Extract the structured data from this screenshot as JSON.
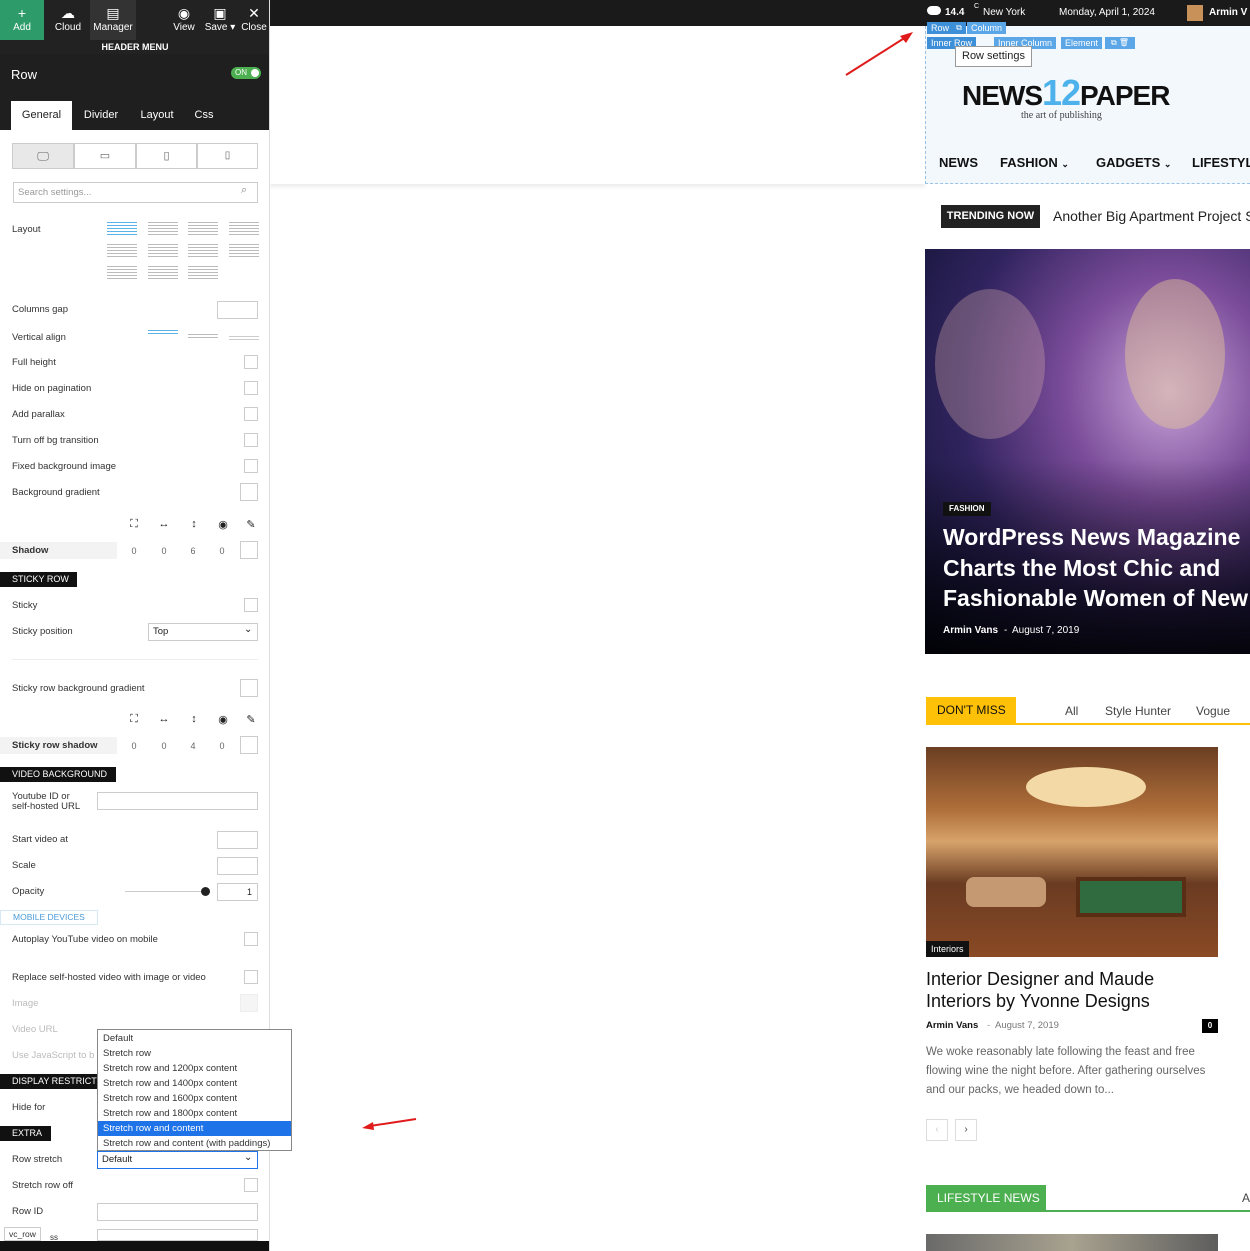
{
  "toolbar": {
    "add": "Add",
    "cloud": "Cloud",
    "manager": "Manager",
    "view": "View",
    "save": "Save ▾",
    "close": "Close"
  },
  "panel": {
    "header_menu": "HEADER MENU",
    "title": "Row",
    "on": "ON",
    "tabs": [
      "General",
      "Divider",
      "Layout",
      "Css"
    ],
    "search_placeholder": "Search settings...",
    "labels": {
      "layout": "Layout",
      "columns_gap": "Columns gap",
      "vertical_align": "Vertical align",
      "full_height": "Full height",
      "hide_pagination": "Hide on pagination",
      "add_parallax": "Add parallax",
      "turn_off_bg": "Turn off bg transition",
      "fixed_bg": "Fixed background image",
      "bg_gradient": "Background gradient",
      "shadow": "Shadow",
      "sticky": "Sticky",
      "sticky_position": "Sticky position",
      "sticky_bg_gradient": "Sticky row background gradient",
      "sticky_shadow": "Sticky row shadow",
      "youtube": "Youtube ID or",
      "youtube2": "self-hosted URL",
      "start_video": "Start video at",
      "scale": "Scale",
      "opacity": "Opacity",
      "autoplay": "Autoplay YouTube video on mobile",
      "replace": "Replace self-hosted video with image or video",
      "image": "Image",
      "video_url": "Video URL",
      "use_js": "Use JavaScript to b",
      "hide_for": "Hide for",
      "row_stretch": "Row stretch",
      "stretch_off": "Stretch row off",
      "row_id": "Row ID",
      "vc_row": "vc_row",
      "extra_class": "ss"
    },
    "shadow_vals": [
      "0",
      "0",
      "6",
      "0"
    ],
    "sticky_shadow_vals": [
      "0",
      "0",
      "4",
      "0"
    ],
    "sections": {
      "sticky_row": "STICKY ROW",
      "video_bg": "VIDEO BACKGROUND",
      "mobile": "MOBILE DEVICES",
      "display": "DISPLAY RESTRICTIO",
      "extra": "EXTRA"
    },
    "sticky_position_value": "Top",
    "opacity_value": "1",
    "row_stretch_value": "Default",
    "dropdown": [
      "Default",
      "Stretch row",
      "Stretch row and 1200px content",
      "Stretch row and 1400px content",
      "Stretch row and 1600px content",
      "Stretch row and 1800px content",
      "Stretch row and content",
      "Stretch row and content (with paddings)"
    ]
  },
  "site": {
    "temp": "14.4",
    "temp_unit": "C",
    "city": "New York",
    "date": "Monday, April 1, 2024",
    "user": "Armin V",
    "builder": {
      "row": "Row",
      "column": "Column",
      "inner_row": "Inner Row",
      "inner_column": "Inner Column",
      "element": "Element",
      "tooltip": "Row settings"
    },
    "logo_news": "NEWS",
    "logo_12": "12",
    "logo_paper": "PAPER",
    "tagline": "the art of publishing",
    "nav": [
      "NEWS",
      "FASHION",
      "GADGETS",
      "LIFESTYLE"
    ],
    "trending_label": "TRENDING NOW",
    "trending_text": "Another Big Apartment Project Sl",
    "hero": {
      "category": "FASHION",
      "title": "WordPress News Magazine Charts the Most Chic and Fashionable Women of New York City",
      "author": "Armin Vans",
      "date": "August 7, 2019"
    },
    "dont_miss": "DON'T MISS",
    "dm_tabs": [
      "All",
      "Style Hunter",
      "Vogue"
    ],
    "article": {
      "category": "Interiors",
      "title": "Interior Designer and Maude Interiors by Yvonne Designs",
      "author": "Armin Vans",
      "date": "August 7, 2019",
      "comments": "0",
      "excerpt": "We woke reasonably late following the feast and free flowing wine the night before. After gathering ourselves and our packs, we headed down to..."
    },
    "lifestyle": "LIFESTYLE NEWS",
    "lifestyle_all": "A"
  }
}
